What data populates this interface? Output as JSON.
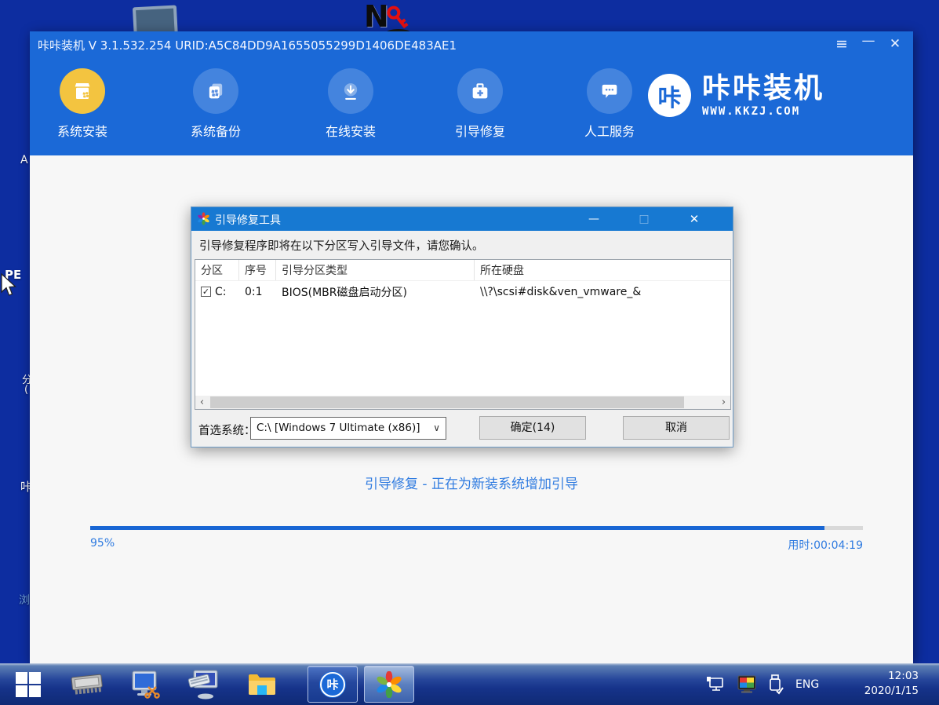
{
  "app": {
    "title": "咔咔装机 V 3.1.532.254 URID:A5C84DD9A1655055299D1406DE483AE1",
    "controls": {
      "menu": "≡",
      "minimize": "—",
      "close": "✕"
    },
    "nav": [
      {
        "label": "系统安装"
      },
      {
        "label": "系统备份"
      },
      {
        "label": "在线安装"
      },
      {
        "label": "引导修复"
      },
      {
        "label": "人工服务"
      }
    ],
    "logo": {
      "badge": "咔",
      "title": "咔咔装机",
      "site": "WWW.KKZJ.COM"
    },
    "status_text": "引导修复 - 正在为新装系统增加引导",
    "progress": {
      "percent": 95,
      "percent_label": "95%",
      "elapsed_label": "用时:00:04:19"
    }
  },
  "dialog": {
    "title": "引导修复工具",
    "controls": {
      "minimize": "—",
      "maximize": "□",
      "close": "✕"
    },
    "message": "引导修复程序即将在以下分区写入引导文件，请您确认。",
    "columns": [
      "分区",
      "序号",
      "引导分区类型",
      "所在硬盘"
    ],
    "row": {
      "check_glyph": "✓",
      "partition": "C:",
      "index": "0:1",
      "type": "BIOS(MBR磁盘启动分区)",
      "disk": "\\\\?\\scsi#disk&ven_vmware_&"
    },
    "scroll": {
      "left": "‹",
      "right": "›"
    },
    "preferred_label": "首选系统：",
    "preferred_value": "C:\\ [Windows 7 Ultimate (x86)]",
    "dropdown_arrow": "∨",
    "ok": "确定(14)",
    "cancel": "取消"
  },
  "desktop": {
    "password_icon_letter": "N",
    "fragments": [
      "A",
      "PE",
      "分",
      "(",
      "咔",
      "浏"
    ]
  },
  "taskbar": {
    "kaka_badge": "咔",
    "lang": "ENG",
    "time": "12:03",
    "date": "2020/1/15"
  }
}
